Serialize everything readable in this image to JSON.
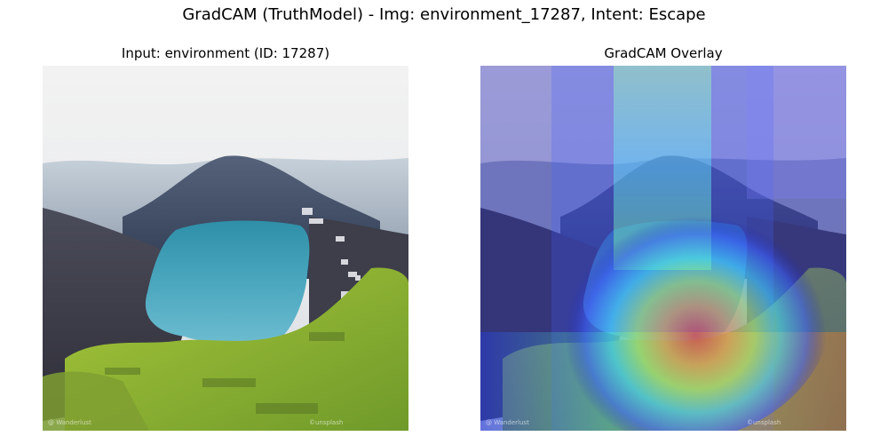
{
  "figure": {
    "suptitle": "GradCAM (TruthModel) - Img: environment_17287, Intent: Escape"
  },
  "panels": [
    {
      "title": "Input: environment (ID: 17287)",
      "content": "landscape photo: crater lake with mountain"
    },
    {
      "title": "GradCAM Overlay",
      "content": "landscape photo with jet-colormap heatmap overlay"
    }
  ],
  "colors": {
    "background": "#ffffff",
    "lake": "#3f9fb5",
    "grass": "#8dbb2f",
    "sky": "#eeeeee",
    "heat_low": "#2d2dff",
    "heat_high": "#ff2a2a"
  }
}
